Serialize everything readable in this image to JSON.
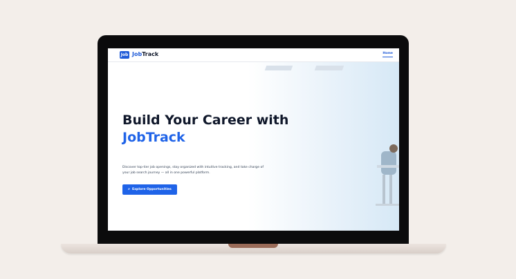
{
  "brand": {
    "logo_mark": "Job",
    "name_primary": "Job",
    "name_secondary": "Track"
  },
  "nav": {
    "home_label": "Home"
  },
  "hero": {
    "title_line1": "Build Your Career with",
    "title_line2": "JobTrack",
    "description": "Discover top-tier job openings, stay organized with intuitive tracking, and take charge of your job search journey — all in one powerful platform.",
    "cta_label": "Explore Opportunities",
    "cta_icon": "search-icon"
  },
  "colors": {
    "accent": "#1f63e8",
    "title": "#0f172a",
    "background": "#f3eeea"
  }
}
